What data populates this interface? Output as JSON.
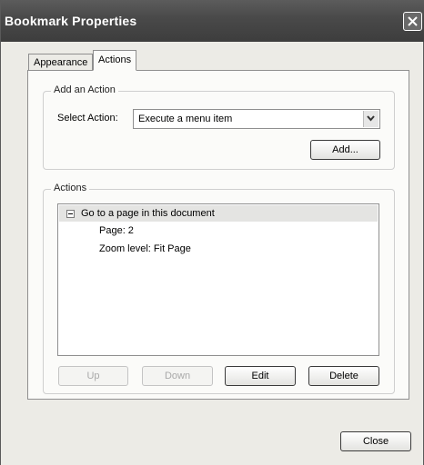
{
  "window": {
    "title": "Bookmark Properties"
  },
  "tabs": [
    {
      "label": "Appearance",
      "active": false
    },
    {
      "label": "Actions",
      "active": true
    }
  ],
  "add_action": {
    "legend": "Add an Action",
    "select_label": "Select Action:",
    "selected_value": "Execute a menu item",
    "add_button": "Add..."
  },
  "actions": {
    "legend": "Actions",
    "tree": {
      "parent": "Go to a page in this document",
      "children": [
        "Page: 2",
        "Zoom level: Fit Page"
      ]
    },
    "buttons": {
      "up": "Up",
      "down": "Down",
      "edit": "Edit",
      "delete": "Delete"
    }
  },
  "footer": {
    "close_button": "Close"
  },
  "icons": {
    "window_close": "close-icon",
    "dropdown": "chevron-down-icon",
    "tree_toggle": "collapse-icon"
  },
  "colors": {
    "titlebar": "#4a4a4a",
    "dialog_bg": "#ecebe6",
    "panel_bg": "#fbfbf9",
    "selection": "#e4e4e2"
  }
}
